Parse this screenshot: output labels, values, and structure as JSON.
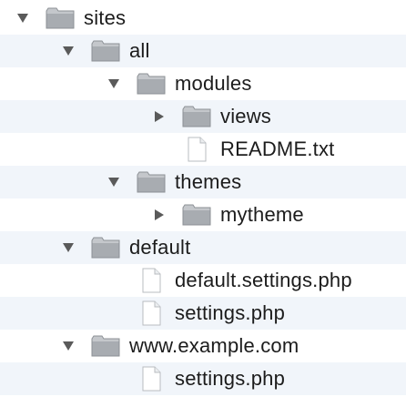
{
  "tree": {
    "items": [
      {
        "label": "sites",
        "type": "folder",
        "expanded": true
      },
      {
        "label": "all",
        "type": "folder",
        "expanded": true
      },
      {
        "label": "modules",
        "type": "folder",
        "expanded": true
      },
      {
        "label": "views",
        "type": "folder",
        "expanded": false
      },
      {
        "label": "README.txt",
        "type": "file"
      },
      {
        "label": "themes",
        "type": "folder",
        "expanded": true
      },
      {
        "label": "mytheme",
        "type": "folder",
        "expanded": false
      },
      {
        "label": "default",
        "type": "folder",
        "expanded": true
      },
      {
        "label": "default.settings.php",
        "type": "file"
      },
      {
        "label": "settings.php",
        "type": "file"
      },
      {
        "label": "www.example.com",
        "type": "folder",
        "expanded": true
      },
      {
        "label": "settings.php",
        "type": "file"
      }
    ]
  },
  "colors": {
    "row_alt": "#f1f5fa",
    "folder": "#9a9ea3",
    "text": "#1c1c1c"
  }
}
